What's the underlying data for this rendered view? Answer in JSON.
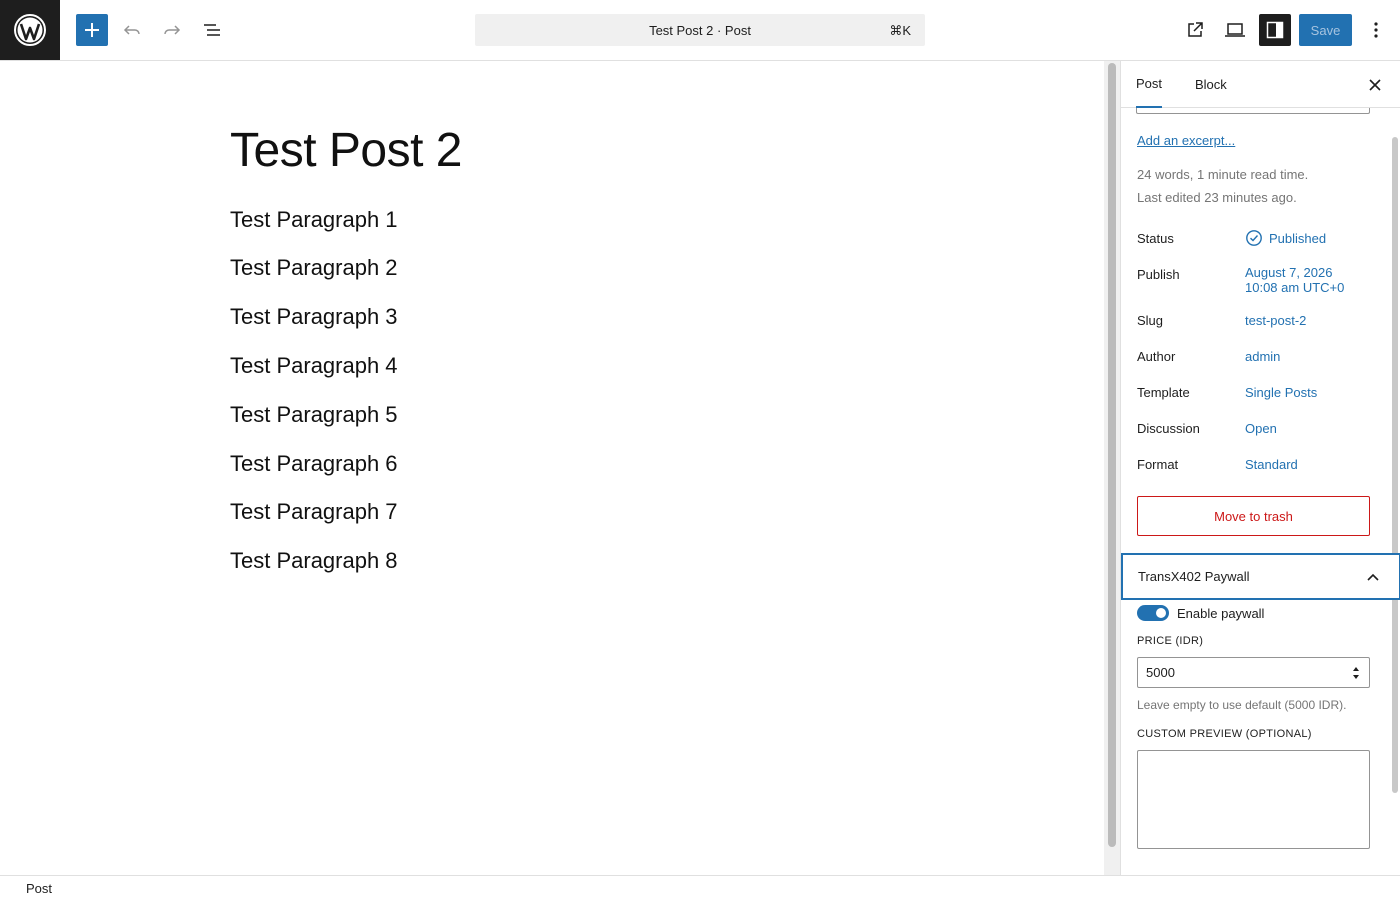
{
  "topbar": {
    "logo_icon": "wordpress-icon",
    "add_block_icon": "plus-icon",
    "undo_icon": "undo-icon",
    "redo_icon": "redo-icon",
    "list_view_icon": "list-view-icon",
    "document_title": "Test Post 2 · Post",
    "shortcut": "⌘K",
    "view_post_icon": "external-link-icon",
    "preview_icon": "device-preview-icon",
    "settings_icon": "sidebar-settings-icon",
    "save_label": "Save",
    "options_icon": "more-vertical-icon"
  },
  "editor": {
    "title": "Test Post 2",
    "paragraphs": [
      "Test Paragraph 1",
      "Test Paragraph 2",
      "Test Paragraph 3",
      "Test Paragraph 4",
      "Test Paragraph 5",
      "Test Paragraph 6",
      "Test Paragraph 7",
      "Test Paragraph 8"
    ]
  },
  "sidebar": {
    "tabs": [
      {
        "label": "Post",
        "active": true
      },
      {
        "label": "Block",
        "active": false
      }
    ],
    "close_icon": "close-icon",
    "excerpt_link": "Add an excerpt...",
    "word_count": "24 words, 1 minute read time.",
    "last_edited": "Last edited 23 minutes ago.",
    "rows": {
      "status": {
        "label": "Status",
        "value": "Published"
      },
      "publish": {
        "label": "Publish",
        "value_line1": "August 7, 2026",
        "value_line2": "10:08 am UTC+0"
      },
      "slug": {
        "label": "Slug",
        "value": "test-post-2"
      },
      "author": {
        "label": "Author",
        "value": "admin"
      },
      "template": {
        "label": "Template",
        "value": "Single Posts"
      },
      "discussion": {
        "label": "Discussion",
        "value": "Open"
      },
      "format": {
        "label": "Format",
        "value": "Standard"
      }
    },
    "trash_label": "Move to trash",
    "paywall": {
      "panel_title": "TransX402 Paywall",
      "enable_label": "Enable paywall",
      "enabled": true,
      "price_label": "PRICE (IDR)",
      "price_value": "5000",
      "help_text": "Leave empty to use default (5000 IDR).",
      "preview_label": "CUSTOM PREVIEW (OPTIONAL)",
      "preview_value": ""
    }
  },
  "footer": {
    "breadcrumb": "Post"
  },
  "colors": {
    "accent": "#2271b1",
    "danger": "#cc1818",
    "dark": "#1e1e1e",
    "muted": "#757575"
  }
}
